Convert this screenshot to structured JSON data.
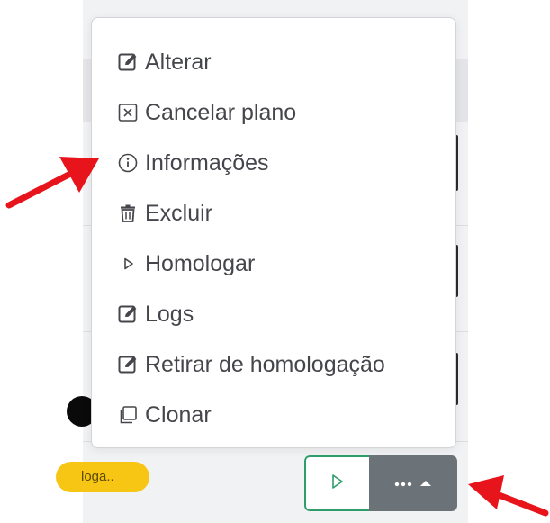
{
  "menu": {
    "items": [
      {
        "label": "Alterar",
        "icon": "edit-icon"
      },
      {
        "label": "Cancelar plano",
        "icon": "close-box-icon"
      },
      {
        "label": "Informações",
        "icon": "info-icon"
      },
      {
        "label": "Excluir",
        "icon": "trash-icon"
      },
      {
        "label": "Homologar",
        "icon": "play-icon"
      },
      {
        "label": "Logs",
        "icon": "edit-icon"
      },
      {
        "label": "Retirar de homologação",
        "icon": "edit-icon"
      },
      {
        "label": "Clonar",
        "icon": "copy-icon"
      }
    ]
  },
  "row": {
    "status_badge": "loga.."
  },
  "actions": {
    "play_icon": "play-outline-icon",
    "more_icon": "more-dots-icon",
    "caret_icon": "caret-up-icon"
  },
  "colors": {
    "accent_green": "#2f9d6a",
    "button_gray": "#6c7378",
    "arrow_red": "#e8141b",
    "badge_yellow": "#f7c614",
    "text": "#45464b"
  }
}
